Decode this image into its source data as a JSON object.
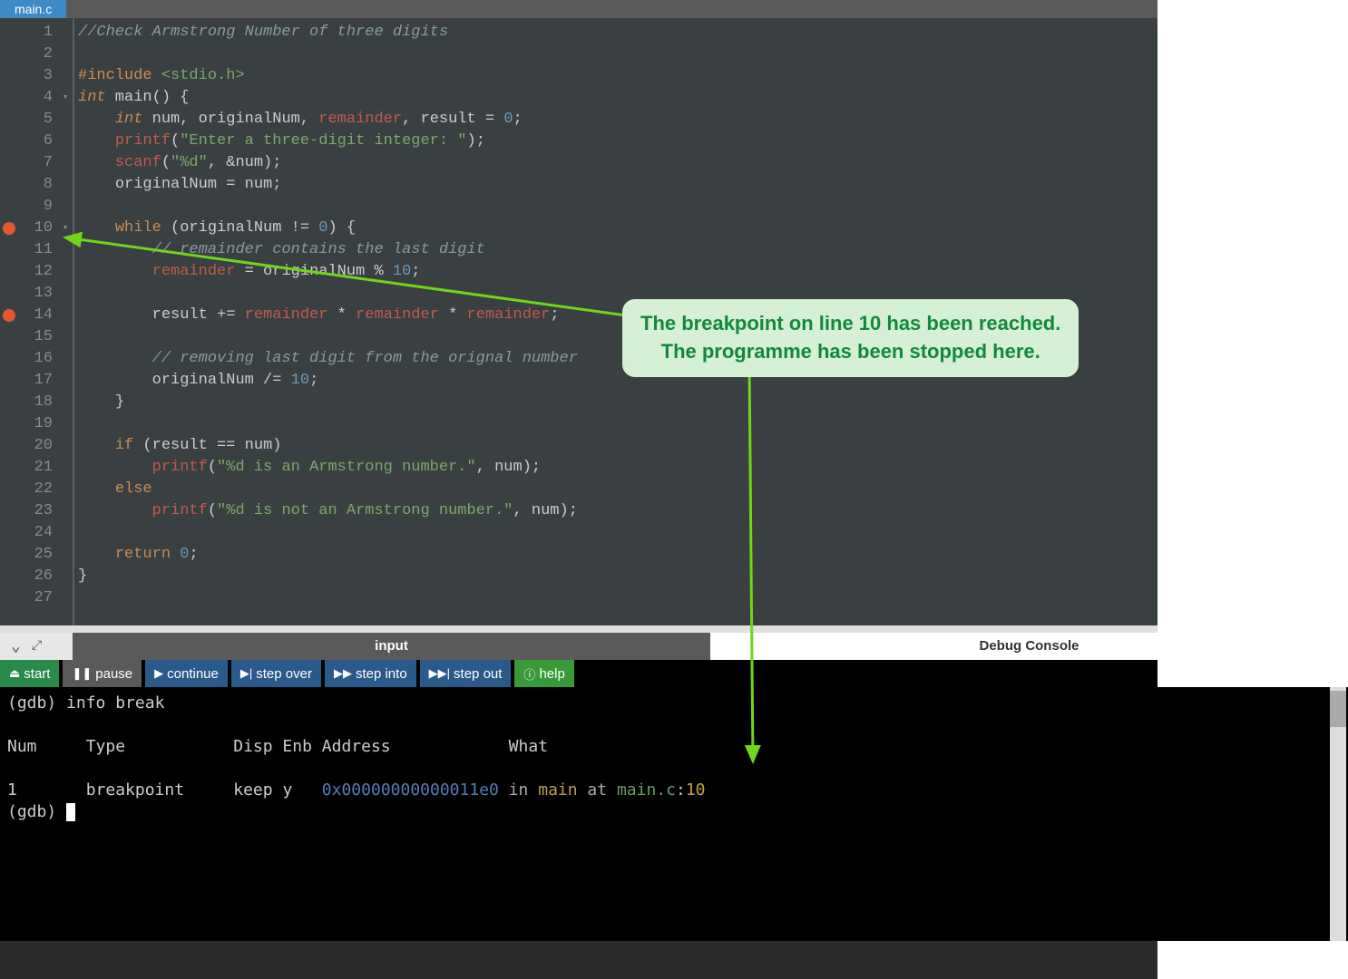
{
  "tab": {
    "filename": "main.c"
  },
  "breakpoints": [
    10,
    14
  ],
  "foldlines": [
    4,
    10
  ],
  "code_lines": [
    1,
    2,
    3,
    4,
    5,
    6,
    7,
    8,
    9,
    10,
    11,
    12,
    13,
    14,
    15,
    16,
    17,
    18,
    19,
    20,
    21,
    22,
    23,
    24,
    25,
    26,
    27
  ],
  "code": {
    "l1_comment": "//Check Armstrong Number of three digits",
    "l3_include": "#include",
    "l3_hdr": " <stdio.h>",
    "l4_int": "int",
    "l4_main": " main() {",
    "l5_int": "int",
    "l5_rest_a": " num, originalNum, ",
    "l5_rem": "remainder",
    "l5_rest_b": ", result = ",
    "l5_zero": "0",
    "l5_semi": ";",
    "l6_printf": "printf",
    "l6_paren": "(",
    "l6_str": "\"Enter a three-digit integer: \"",
    "l6_close": ");",
    "l7_scanf": "scanf",
    "l7_paren": "(",
    "l7_str": "\"%d\"",
    "l7_rest": ", &num);",
    "l8_text": "originalNum = num;",
    "l10_while": "while",
    "l10_rest_a": " (originalNum != ",
    "l10_zero": "0",
    "l10_rest_b": ") {",
    "l11_comment": "// remainder contains the last digit",
    "l12_rem": "remainder",
    "l12_eq": " = originalNum % ",
    "l12_ten": "10",
    "l12_semi": ";",
    "l14_res": "result += ",
    "l14_rem1": "remainder",
    "l14_star1": " * ",
    "l14_rem2": "remainder",
    "l14_star2": " * ",
    "l14_rem3": "remainder",
    "l14_semi": ";",
    "l16_comment": "// removing last digit from the orignal number",
    "l17_text_a": "originalNum /= ",
    "l17_ten": "10",
    "l17_semi": ";",
    "l18_brace": "}",
    "l20_if": "if",
    "l20_rest": " (result == num)",
    "l21_printf": "printf",
    "l21_paren": "(",
    "l21_str": "\"%d is an Armstrong number.\"",
    "l21_rest": ", num);",
    "l22_else": "else",
    "l23_printf": "printf",
    "l23_paren": "(",
    "l23_str": "\"%d is not an Armstrong number.\"",
    "l23_rest": ", num);",
    "l25_return": "return",
    "l25_sp": " ",
    "l25_zero": "0",
    "l25_semi": ";",
    "l26_brace": "}"
  },
  "bottom": {
    "input_tab": "input",
    "debug_tab": "Debug Console"
  },
  "toolbar": {
    "start": "start",
    "pause": "pause",
    "continue": "continue",
    "stepover": "step over",
    "stepinto": "step into",
    "stepout": "step out",
    "help": "help"
  },
  "console": {
    "l1_prompt": "(gdb) ",
    "l1_cmd": "info break",
    "l3_hdr": "Num     Type           Disp Enb Address            What",
    "l5_num": "1",
    "l5_type": "       breakpoint     keep y   ",
    "l5_addr": "0x00000000000011e0",
    "l5_in": " in ",
    "l5_main": "main",
    "l5_at": " at ",
    "l5_file": "main.c",
    "l5_colon": ":",
    "l5_line": "10",
    "l6_prompt": "(gdb) "
  },
  "callout": {
    "line1": "The breakpoint on line 10 has been reached.",
    "line2": "The programme has been stopped here."
  }
}
